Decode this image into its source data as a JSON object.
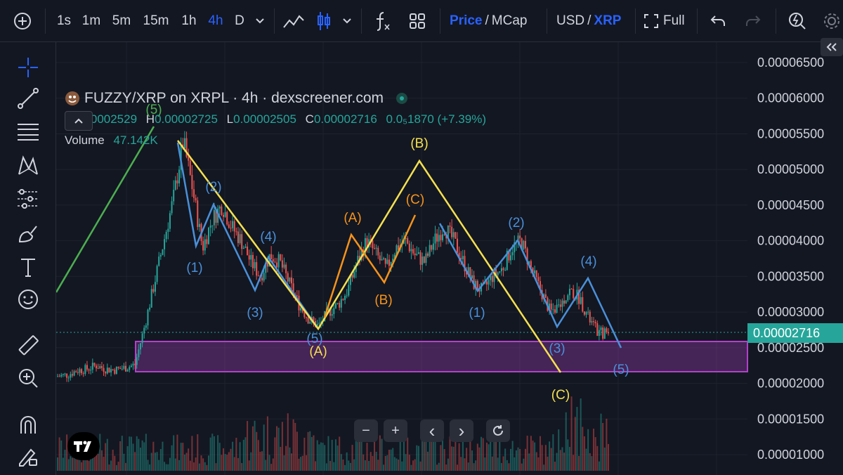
{
  "toolbar": {
    "add_icon": "plus-circle-icon",
    "intervals": [
      "1s",
      "1m",
      "5m",
      "15m",
      "1h",
      "4h",
      "D"
    ],
    "active_interval": "4h",
    "price_label": "Price",
    "mcap_label": "MCap",
    "price_sep": "/",
    "usd_label": "USD",
    "xrp_label": "XRP",
    "currency_sep": "/",
    "full_label": "Full"
  },
  "legend": {
    "title": "FUZZY/XRP on XRPL · 4h · dexscreener.com",
    "o_key": "O",
    "o_val": "0.00002529",
    "h_key": "H",
    "h_val": "0.00002725",
    "l_key": "L",
    "l_val": "0.00002505",
    "c_key": "C",
    "c_val": "0.00002716",
    "change": "0.0₅1870 (+7.39%)",
    "volume_label": "Volume",
    "volume_val": "47.142K"
  },
  "price_axis": {
    "labels": [
      "0.00006500",
      "0.00006000",
      "0.00005500",
      "0.00005000",
      "0.00004500",
      "0.00004000",
      "0.00003500",
      "0.00003000",
      "0.00002500",
      "0.00002000",
      "0.00001500",
      "0.00001000"
    ],
    "current_price": "0.00002716"
  },
  "annotations": {
    "wave5_top": "(5)",
    "b1": "(1)",
    "b2": "(2)",
    "b3": "(3)",
    "b4": "(4)",
    "b5": "(5)",
    "yA": "(A)",
    "yB": "(B)",
    "yC": "(C)",
    "oA": "(A)",
    "oB": "(B)",
    "oC": "(C)",
    "r1": "(1)",
    "r2": "(2)",
    "r3": "(3)",
    "r4": "(4)",
    "r5": "(5)"
  },
  "controls": {
    "zoom_out": "−",
    "zoom_in": "+",
    "left": "‹",
    "right": "›"
  },
  "colors": {
    "background": "#131722",
    "up": "#26a69a",
    "down": "#ef5350",
    "wave_blue": "#4a90d9",
    "wave_yellow": "#f5e050",
    "wave_orange": "#f7931a",
    "wave_green": "#4caf50",
    "zone": "#b042c8"
  },
  "chart_data": {
    "type": "candlestick",
    "title": "FUZZY/XRP on XRPL · 4h · dexscreener.com",
    "ylim": [
      1e-05,
      6.5e-05
    ],
    "y_ticks": [
      6.5e-05,
      6e-05,
      5.5e-05,
      5e-05,
      4.5e-05,
      4e-05,
      3.5e-05,
      3e-05,
      2.5e-05,
      2e-05,
      1.5e-05,
      1e-05
    ],
    "last_close": 2.716e-05,
    "support_zone": [
      2.15e-05,
      2.6e-05
    ],
    "close_series": [
      2.1e-05,
      2.12e-05,
      2.18e-05,
      2.2e-05,
      2.25e-05,
      2.2e-05,
      2.19e-05,
      2.22e-05,
      2.26e-05,
      2.8e-05,
      3.4e-05,
      4e-05,
      4.6e-05,
      5.4e-05,
      4.7e-05,
      3.9e-05,
      4.3e-05,
      4.5e-05,
      4.2e-05,
      4e-05,
      3.7e-05,
      3.5e-05,
      3.8e-05,
      3.7e-05,
      3.4e-05,
      3.1e-05,
      2.9e-05,
      2.8e-05,
      3e-05,
      3.1e-05,
      3.3e-05,
      3.7e-05,
      4e-05,
      3.8e-05,
      3.6e-05,
      3.9e-05,
      4e-05,
      3.8e-05,
      3.7e-05,
      4e-05,
      4.2e-05,
      4e-05,
      3.7e-05,
      3.4e-05,
      3.3e-05,
      3.5e-05,
      3.6e-05,
      3.9e-05,
      4e-05,
      3.6e-05,
      3.3e-05,
      3e-05,
      3.1e-05,
      3.3e-05,
      3.2e-05,
      2.9e-05,
      2.7e-05,
      2.716e-05
    ]
  }
}
